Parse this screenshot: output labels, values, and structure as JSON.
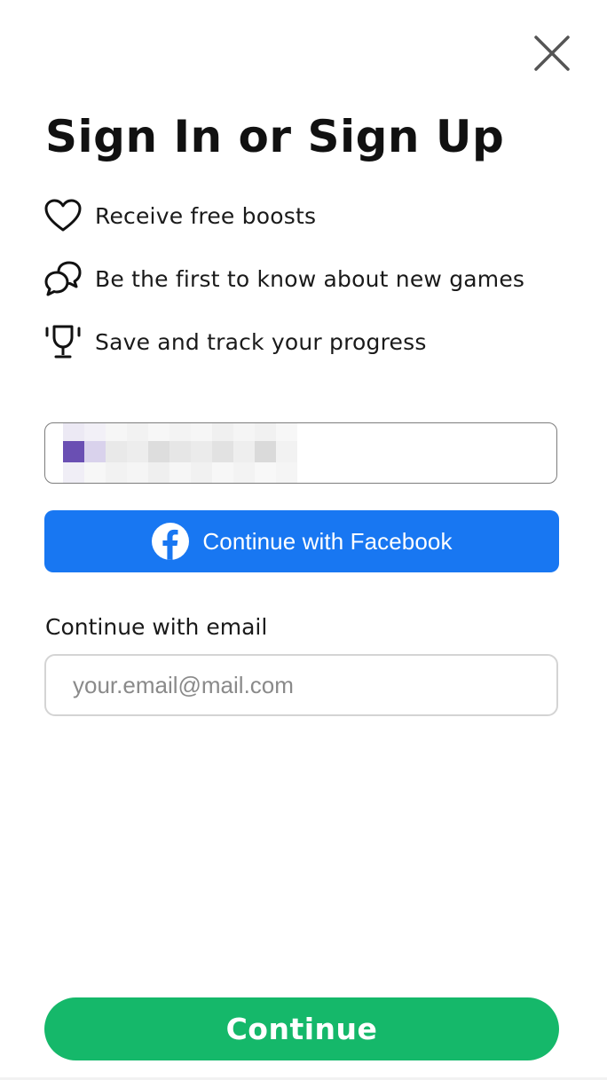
{
  "dialog": {
    "title": "Sign In or Sign Up",
    "close_icon": "close-icon"
  },
  "benefits": [
    {
      "icon": "heart-icon",
      "label": "Receive free boosts"
    },
    {
      "icon": "chat-bubbles-icon",
      "label": "Be the first to know about new games"
    },
    {
      "icon": "trophy-icon",
      "label": "Save and track your progress"
    }
  ],
  "account_chip": {
    "content": "pixelated-redacted-account"
  },
  "facebook": {
    "label": "Continue with Facebook",
    "icon": "facebook-icon",
    "color": "#1877f2"
  },
  "email": {
    "label": "Continue with email",
    "value": "",
    "placeholder": "your.email@mail.com"
  },
  "continue": {
    "label": "Continue",
    "color": "#15b86a"
  }
}
